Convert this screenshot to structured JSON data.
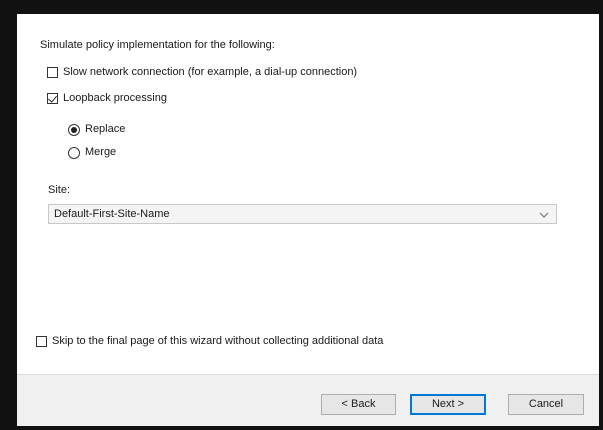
{
  "wizard": {
    "heading": "Simulate policy implementation for the following:",
    "options": {
      "slow_network_label": "Slow network connection (for example, a dial-up connection)",
      "slow_network_checked": false,
      "loopback_label": "Loopback processing",
      "loopback_checked": true,
      "loopback_modes": [
        {
          "label": "Replace",
          "selected": true
        },
        {
          "label": "Merge",
          "selected": false
        }
      ]
    },
    "site": {
      "label": "Site:",
      "selected_value": "Default-First-Site-Name"
    },
    "skip_label": "Skip to the final page of this wizard without collecting additional data",
    "skip_checked": false
  },
  "buttons": {
    "back": "< Back",
    "next": "Next >",
    "cancel": "Cancel"
  },
  "icons": {
    "dropdown": "chevron-down-icon"
  }
}
